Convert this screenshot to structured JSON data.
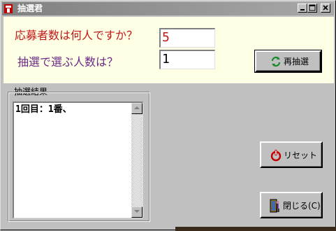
{
  "window": {
    "title": "抽選君",
    "icons": {
      "app": "app-lottery-icon",
      "minimize": "minimize-icon",
      "maximize": "maximize-icon",
      "close": "close-icon"
    }
  },
  "form": {
    "applicants_label": "応募者数は何人ですか？",
    "applicants_value": "5",
    "winners_label": "抽選で選ぶ人数は？",
    "winners_value": "1"
  },
  "buttons": {
    "redraw": "再抽選",
    "reset": "リセット",
    "close": "閉じる(C)"
  },
  "results": {
    "group_title": "抽選結果",
    "text": "1回目：1番、"
  },
  "colors": {
    "panel_bg": "#ffffe6",
    "question1": "#c01818",
    "question2": "#6a2a86",
    "face": "#c0c0c0"
  }
}
